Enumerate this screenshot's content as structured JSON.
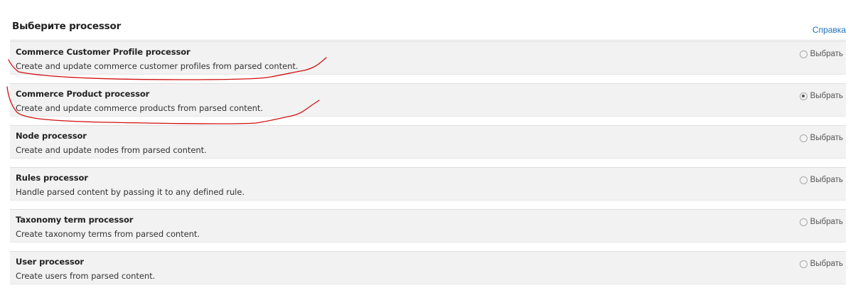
{
  "header": {
    "title": "Выберите processor",
    "help_label": "Справка"
  },
  "processors": [
    {
      "title": "Commerce Customer Profile processor",
      "description": "Create and update commerce customer profiles from parsed content.",
      "choice_label": "Выбрать",
      "selected": false
    },
    {
      "title": "Commerce Product processor",
      "description": "Create and update commerce products from parsed content.",
      "choice_label": "Выбрать",
      "selected": true
    },
    {
      "title": "Node processor",
      "description": "Create and update nodes from parsed content.",
      "choice_label": "Выбрать",
      "selected": false
    },
    {
      "title": "Rules processor",
      "description": "Handle parsed content by passing it to any defined rule.",
      "choice_label": "Выбрать",
      "selected": false
    },
    {
      "title": "Taxonomy term processor",
      "description": "Create taxonomy terms from parsed content.",
      "choice_label": "Выбрать",
      "selected": false
    },
    {
      "title": "User processor",
      "description": "Create users from parsed content.",
      "choice_label": "Выбрать",
      "selected": false
    }
  ],
  "colors": {
    "link": "#1e6fb8",
    "row_background": "#f2f2f2",
    "annotation_stroke": "#d01010"
  }
}
